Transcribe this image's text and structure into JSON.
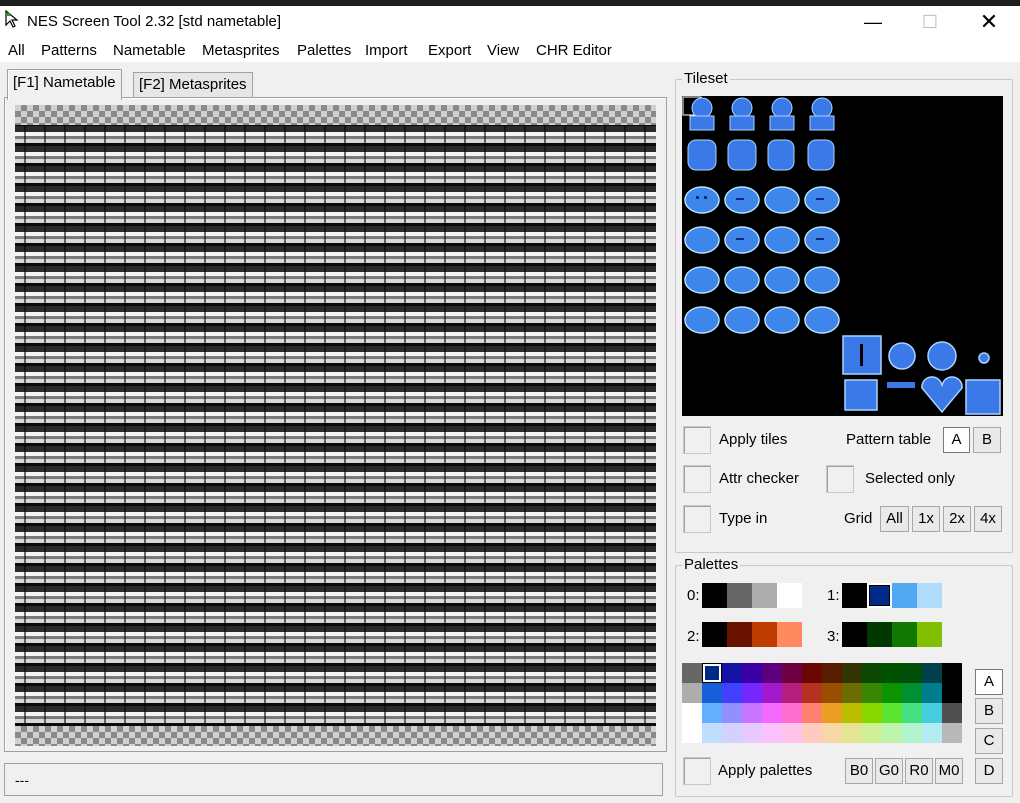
{
  "window": {
    "title": "NES Screen Tool 2.32  [std nametable]"
  },
  "menu": [
    "All",
    "Patterns",
    "Nametable",
    "Metasprites",
    "Palettes",
    "Import",
    "Export",
    "View",
    "CHR Editor"
  ],
  "tabs": {
    "nametable": "[F1] Nametable",
    "metasprites": "[F2] Metasprites"
  },
  "status": {
    "text": "---"
  },
  "tileset": {
    "title": "Tileset",
    "apply_tiles": "Apply tiles",
    "pattern_table_label": "Pattern table",
    "pattern_a": "A",
    "pattern_b": "B",
    "attr_checker": "Attr checker",
    "selected_only": "Selected only",
    "type_in": "Type in",
    "grid_label": "Grid",
    "grid_all": "All",
    "grid_1x": "1x",
    "grid_2x": "2x",
    "grid_4x": "4x"
  },
  "palettes": {
    "title": "Palettes",
    "labels": [
      "0:",
      "1:",
      "2:",
      "3:"
    ],
    "sets": [
      [
        "#000000",
        "#666666",
        "#adadad",
        "#ffffff"
      ],
      [
        "#000000",
        "#002a88",
        "#4fa8f0",
        "#b0dcfc"
      ],
      [
        "#000000",
        "#6a1200",
        "#be3c00",
        "#ff8a60"
      ],
      [
        "#000000",
        "#003800",
        "#107800",
        "#80c000"
      ]
    ],
    "master": [
      [
        "#666666",
        "#002a88",
        "#1412a7",
        "#3b00a4",
        "#5c007e",
        "#6e0040",
        "#6c0600",
        "#561d00",
        "#333500",
        "#0b4800",
        "#005200",
        "#004f08",
        "#00404d",
        "#000000"
      ],
      [
        "#adadad",
        "#155fd9",
        "#4240ff",
        "#7527fe",
        "#a01acc",
        "#b71e7b",
        "#b53120",
        "#994e00",
        "#6b6d00",
        "#388700",
        "#0c9300",
        "#008f32",
        "#007c8d",
        "#000000"
      ],
      [
        "#ffffff",
        "#64b0ff",
        "#9290ff",
        "#c676ff",
        "#f36aff",
        "#fe6ecc",
        "#fe8170",
        "#ea9e22",
        "#bcbe00",
        "#88d800",
        "#5ce430",
        "#45e082",
        "#48cdde",
        "#4f4f4f"
      ],
      [
        "#ffffff",
        "#c0dfff",
        "#d3d2ff",
        "#e8c8ff",
        "#fbc2ff",
        "#fec4ea",
        "#fecbc1",
        "#f7d8a5",
        "#e4e594",
        "#cfef96",
        "#bdf4ab",
        "#b3f3cc",
        "#b5ebf2",
        "#b8b8b8"
      ]
    ],
    "side_buttons": [
      "A",
      "B",
      "C",
      "D"
    ],
    "apply_palettes": "Apply palettes",
    "bottom_buttons": [
      "B0",
      "G0",
      "R0",
      "M0"
    ]
  }
}
